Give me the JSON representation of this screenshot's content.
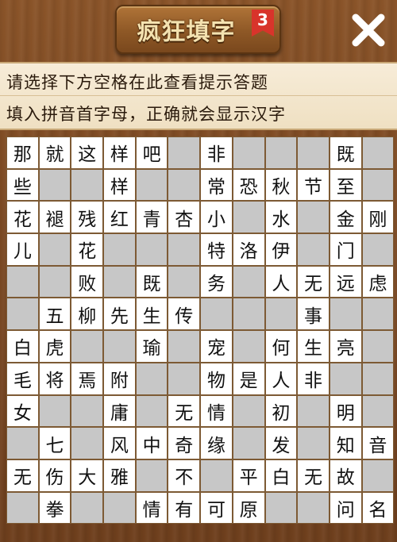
{
  "header": {
    "title": "疯狂填字",
    "level": "3",
    "close_icon": "close-x-icon"
  },
  "hints": {
    "line1": "请选择下方空格在此查看提示答题",
    "line2": "填入拼音首字母，正确就会显示汉字"
  },
  "colors": {
    "cell_white": "#ffffff",
    "cell_gray": "#c7c7c7",
    "badge_red": "#d8342b"
  },
  "grid": {
    "rows": [
      [
        "那",
        "就",
        "这",
        "样",
        "吧",
        "#",
        "非",
        "#",
        "#",
        "#",
        "既",
        "#"
      ],
      [
        "些",
        "",
        "",
        "样",
        "",
        "",
        "常",
        "恐",
        "秋",
        "节",
        "至",
        ""
      ],
      [
        "花",
        "褪",
        "残",
        "红",
        "青",
        "杏",
        "小",
        "",
        "水",
        "",
        "金",
        "刚"
      ],
      [
        "儿",
        "",
        "花",
        "",
        "",
        "",
        "特",
        "洛",
        "伊",
        "",
        "门",
        ""
      ],
      [
        "",
        "",
        "败",
        "",
        "既",
        "",
        "务",
        "",
        "人",
        "无",
        "远",
        "虑"
      ],
      [
        "",
        "五",
        "柳",
        "先",
        "生",
        "传",
        "",
        "",
        "",
        "事",
        "",
        ""
      ],
      [
        "白",
        "虎",
        "",
        "",
        "瑜",
        "",
        "宠",
        "",
        "何",
        "生",
        "亮",
        ""
      ],
      [
        "毛",
        "将",
        "焉",
        "附",
        "",
        "",
        "物",
        "是",
        "人",
        "非",
        "",
        ""
      ],
      [
        "女",
        "",
        "",
        "庸",
        "",
        "无",
        "情",
        "",
        "初",
        "",
        "明",
        ""
      ],
      [
        "",
        "七",
        "",
        "风",
        "中",
        "奇",
        "缘",
        "",
        "发",
        "",
        "知",
        "音"
      ],
      [
        "无",
        "伤",
        "大",
        "雅",
        "",
        "不",
        "",
        "平",
        "白",
        "无",
        "故",
        ""
      ],
      [
        "",
        "拳",
        "",
        "",
        "情",
        "有",
        "可",
        "原",
        "",
        "",
        "问",
        "名"
      ]
    ],
    "white_map": [
      [
        1,
        1,
        1,
        1,
        1,
        0,
        1,
        0,
        0,
        0,
        1,
        0
      ],
      [
        1,
        0,
        0,
        1,
        0,
        0,
        1,
        1,
        1,
        1,
        1,
        0
      ],
      [
        1,
        1,
        1,
        1,
        1,
        1,
        1,
        0,
        1,
        0,
        1,
        1
      ],
      [
        1,
        0,
        1,
        0,
        0,
        0,
        1,
        1,
        1,
        0,
        1,
        0
      ],
      [
        0,
        0,
        1,
        0,
        1,
        0,
        1,
        0,
        1,
        1,
        1,
        1
      ],
      [
        0,
        1,
        1,
        1,
        1,
        1,
        0,
        0,
        0,
        1,
        0,
        0
      ],
      [
        1,
        1,
        0,
        0,
        1,
        0,
        1,
        0,
        1,
        1,
        1,
        0
      ],
      [
        1,
        1,
        1,
        1,
        0,
        0,
        1,
        1,
        1,
        1,
        0,
        0
      ],
      [
        1,
        0,
        0,
        1,
        0,
        1,
        1,
        0,
        1,
        0,
        1,
        0
      ],
      [
        0,
        1,
        0,
        1,
        1,
        1,
        1,
        0,
        1,
        0,
        1,
        1
      ],
      [
        1,
        1,
        1,
        1,
        0,
        1,
        0,
        1,
        1,
        1,
        1,
        0
      ],
      [
        0,
        1,
        0,
        0,
        1,
        1,
        1,
        1,
        0,
        0,
        1,
        1
      ]
    ]
  }
}
